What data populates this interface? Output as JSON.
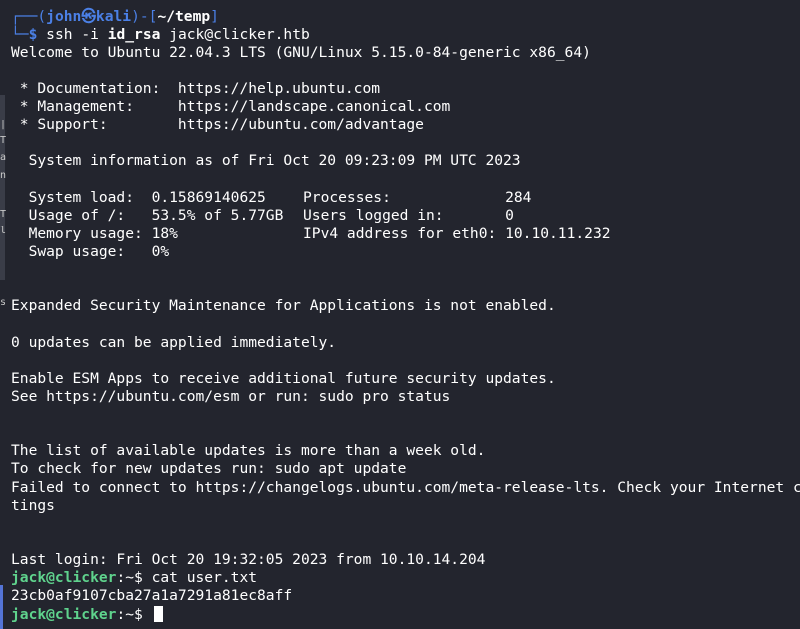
{
  "prompt": {
    "box_top": "┌──(",
    "user": "john",
    "at_symbol": "㉿",
    "host": "kali",
    "mid": ")-[",
    "path": "~/temp",
    "end": "]",
    "box_bottom": "└─",
    "dollar": "$",
    "cmd_ssh": "ssh -i",
    "cmd_key": "id_rsa",
    "cmd_target": "jack@clicker.htb"
  },
  "banner": {
    "welcome": "Welcome to Ubuntu 22.04.3 LTS (GNU/Linux 5.15.0-84-generic x86_64)",
    "doc": " * Documentation:  https://help.ubuntu.com",
    "mgmt": " * Management:     https://landscape.canonical.com",
    "support": " * Support:        https://ubuntu.com/advantage",
    "sysinfo": "  System information as of Fri Oct 20 09:23:09 PM UTC 2023"
  },
  "stats": {
    "left": [
      "  System load:  0.15869140625",
      "  Usage of /:   53.5% of 5.77GB",
      "  Memory usage: 18%",
      "  Swap usage:   0%"
    ],
    "right": [
      "Processes:             284",
      "Users logged in:       0",
      "IPv4 address for eth0: 10.10.11.232"
    ]
  },
  "messages": {
    "esm_status": "Expanded Security Maintenance for Applications is not enabled.",
    "updates": "0 updates can be applied immediately.",
    "esm_enable": "Enable ESM Apps to receive additional future security updates.",
    "esm_see": "See https://ubuntu.com/esm or run: sudo pro status",
    "list_old": "The list of available updates is more than a week old.",
    "check_updates": "To check for new updates run: sudo apt update",
    "failed": "Failed to connect to https://changelogs.ubuntu.com/meta-release-lts. Check your Internet con",
    "failed_wrap": "tings",
    "last_login": "Last login: Fri Oct 20 19:32:05 2023 from 10.10.14.204"
  },
  "remote": {
    "user_host": "jack@clicker",
    "sep": ":~$ ",
    "cmd": "cat user.txt",
    "flag": "23cb0af9107cba27a1a7291a81ec8aff",
    "prompt_end": ":~$ "
  },
  "left_edge_glyphs": [
    "|",
    "T",
    "a",
    "n",
    "T",
    "ll",
    "s"
  ],
  "colors": {
    "background": "#23252e",
    "prompt_blue": "#4b80e6",
    "remote_green": "#5fd38d",
    "text": "#ffffff"
  }
}
